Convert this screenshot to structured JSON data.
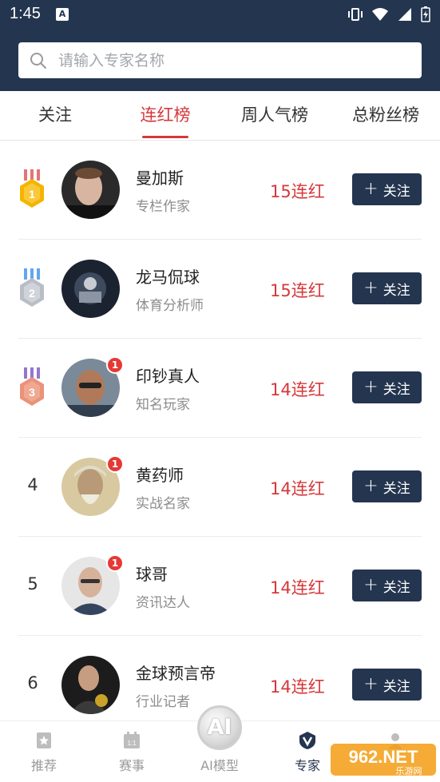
{
  "status_bar": {
    "time": "1:45",
    "notification_icon": "A"
  },
  "search": {
    "placeholder": "请输入专家名称"
  },
  "tabs": [
    {
      "label": "关注",
      "active": false
    },
    {
      "label": "连红榜",
      "active": true
    },
    {
      "label": "周人气榜",
      "active": false
    },
    {
      "label": "总粉丝榜",
      "active": false
    }
  ],
  "experts": [
    {
      "rank": "1",
      "medal": "gold",
      "name": "曼加斯",
      "title": "专栏作家",
      "streak": "15连红",
      "badge": "",
      "follow_label": "关注"
    },
    {
      "rank": "2",
      "medal": "silver",
      "name": "龙马侃球",
      "title": "体育分析师",
      "streak": "15连红",
      "badge": "",
      "follow_label": "关注"
    },
    {
      "rank": "3",
      "medal": "bronze",
      "name": "印钞真人",
      "title": "知名玩家",
      "streak": "14连红",
      "badge": "1",
      "follow_label": "关注"
    },
    {
      "rank": "4",
      "medal": "",
      "name": "黄药师",
      "title": "实战名家",
      "streak": "14连红",
      "badge": "1",
      "follow_label": "关注"
    },
    {
      "rank": "5",
      "medal": "",
      "name": "球哥",
      "title": "资讯达人",
      "streak": "14连红",
      "badge": "1",
      "follow_label": "关注"
    },
    {
      "rank": "6",
      "medal": "",
      "name": "金球预言帝",
      "title": "行业记者",
      "streak": "14连红",
      "badge": "",
      "follow_label": "关注"
    }
  ],
  "bottom_nav": [
    {
      "label": "推荐",
      "icon": "star-card-icon",
      "active": false
    },
    {
      "label": "赛事",
      "icon": "calendar-icon",
      "active": false
    },
    {
      "label": "AI模型",
      "icon": "ai-icon",
      "active": false
    },
    {
      "label": "专家",
      "icon": "v-shield-icon",
      "active": true
    },
    {
      "label": "",
      "icon": "person-icon",
      "active": false
    }
  ],
  "ai_logo_text": "AI",
  "watermark": {
    "text": "962.NET",
    "subtext": "乐游网"
  },
  "colors": {
    "header": "#24354f",
    "accent_red": "#d6383a",
    "follow_button": "#24354f"
  }
}
